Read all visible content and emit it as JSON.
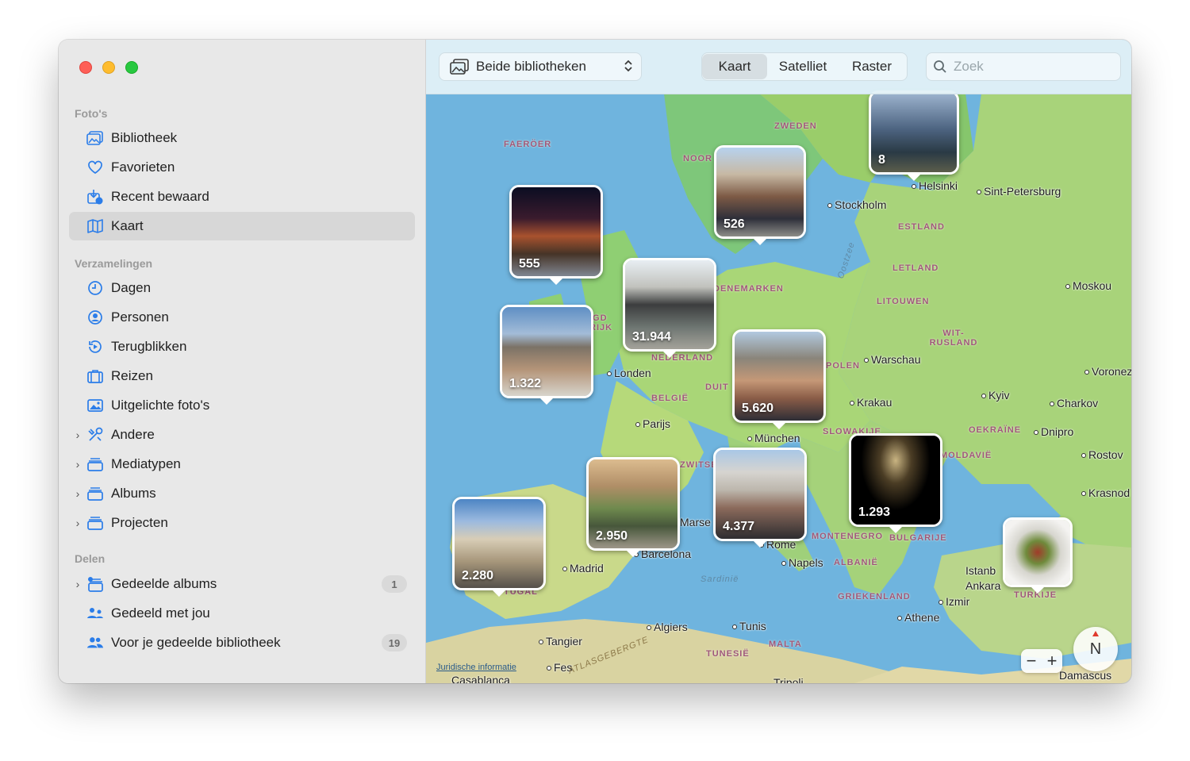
{
  "sidebar": {
    "sections": [
      {
        "title": "Foto's"
      },
      {
        "title": "Verzamelingen"
      },
      {
        "title": "Delen"
      }
    ],
    "items": [
      {
        "label": "Bibliotheek",
        "icon": "photo-library-icon"
      },
      {
        "label": "Favorieten",
        "icon": "heart-icon"
      },
      {
        "label": "Recent bewaard",
        "icon": "recent-saved-icon"
      },
      {
        "label": "Kaart",
        "icon": "map-icon",
        "selected": true
      },
      {
        "label": "Dagen",
        "icon": "clock-icon"
      },
      {
        "label": "Personen",
        "icon": "person-icon"
      },
      {
        "label": "Terugblikken",
        "icon": "memories-icon"
      },
      {
        "label": "Reizen",
        "icon": "suitcase-icon"
      },
      {
        "label": "Uitgelichte foto's",
        "icon": "featured-photo-icon"
      },
      {
        "label": "Andere",
        "icon": "tools-icon"
      },
      {
        "label": "Mediatypen",
        "icon": "stack-icon"
      },
      {
        "label": "Albums",
        "icon": "stack-icon"
      },
      {
        "label": "Projecten",
        "icon": "stack-icon"
      },
      {
        "label": "Gedeelde albums",
        "icon": "shared-albums-icon",
        "badge": "1"
      },
      {
        "label": "Gedeeld met jou",
        "icon": "shared-with-you-icon"
      },
      {
        "label": "Voor je gedeelde bibliotheek",
        "icon": "people-icon",
        "badge": "19"
      }
    ]
  },
  "toolbar": {
    "library_select": "Beide bibliotheken",
    "segments": [
      "Kaart",
      "Satelliet",
      "Raster"
    ],
    "active_segment": "Kaart",
    "search_placeholder": "Zoek"
  },
  "map": {
    "cities": [
      "Helsinki",
      "Sint-Petersburg",
      "Stockholm",
      "Moskou",
      "Londen",
      "Warschau",
      "Voronez",
      "Kyiv",
      "Charkov",
      "Krakau",
      "Parijs",
      "München",
      "Dnipro",
      "Rostov",
      "Krasnod",
      "Madrid",
      "Barcelona",
      "Marse",
      "Rome",
      "Napels",
      "Istanb",
      "Ankara",
      "Izmir",
      "Athene",
      "Algiers",
      "Tunis",
      "Tangier",
      "Fes",
      "Casablanca",
      "Tripoli",
      "Damascus"
    ],
    "countries": [
      "ZWEDEN",
      "FAERÖER",
      "NOOR",
      "ESTLAND",
      "LETLAND",
      "LITOUWEN",
      "WIT-RUSLAND",
      "OEKRAÏNE",
      "POLEN",
      "DUIT",
      "BELGIË",
      "NEDERLAND",
      "DENEMARKEN",
      "ZWITSE",
      "SLOWAKIJE",
      "MOLDAVIË",
      "MONTENEGRO",
      "BULGARIJE",
      "ALBANIË",
      "GRIEKENLAND",
      "TURKIJE",
      "MALTA",
      "TUNESIË",
      "TUGAL",
      "IGD RIJK"
    ],
    "seas": [
      "Oostzee",
      "Sardinië",
      "ATLASGEBERGTE"
    ],
    "pins": [
      {
        "count": "8"
      },
      {
        "count": "526"
      },
      {
        "count": "555"
      },
      {
        "count": "31.944"
      },
      {
        "count": "1.322"
      },
      {
        "count": "5.620"
      },
      {
        "count": "1.293"
      },
      {
        "count": "2.950"
      },
      {
        "count": "4.377"
      },
      {
        "count": "2.280"
      },
      {
        "count": ""
      }
    ],
    "legal": "Juridische informatie",
    "compass": "N",
    "zoom_out": "−",
    "zoom_in": "+"
  }
}
